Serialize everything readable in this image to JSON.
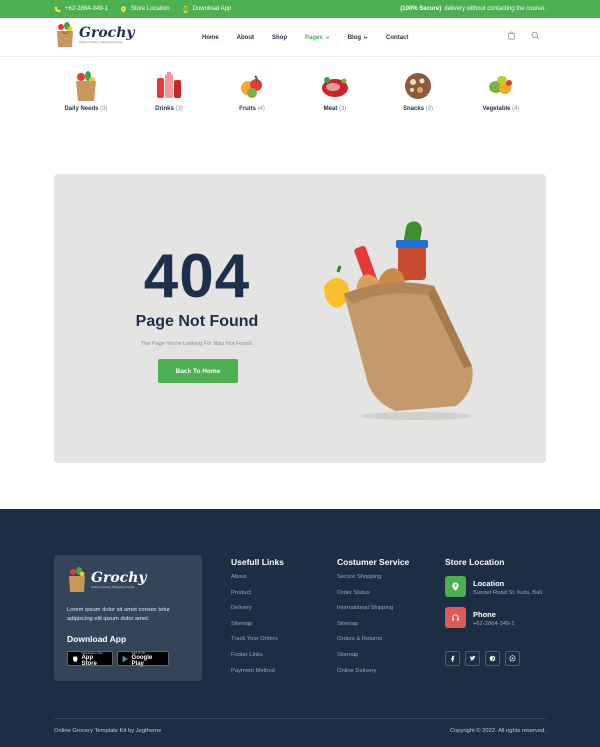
{
  "topbar": {
    "phone": "+62-2864-349-1",
    "store_location": "Store Location",
    "download_app": "Download App",
    "secure_bold": "(100% Secure)",
    "secure_text": "delivery without contacting the courier."
  },
  "brand": {
    "name": "Grochy",
    "tagline": "Online Grocery Shopping Center",
    "accent": "#4caf50",
    "navy": "#1e2f4d"
  },
  "nav": {
    "items": [
      {
        "label": "Home"
      },
      {
        "label": "About"
      },
      {
        "label": "Shop"
      },
      {
        "label": "Pages"
      },
      {
        "label": "Blog"
      },
      {
        "label": "Contact"
      }
    ],
    "active": "Pages"
  },
  "categories": [
    {
      "name": "Daily Needs",
      "count": "(3)",
      "icon": "bag-icon"
    },
    {
      "name": "Drinks",
      "count": "(3)",
      "icon": "drinks-icon"
    },
    {
      "name": "Fruits",
      "count": "(4)",
      "icon": "fruits-icon"
    },
    {
      "name": "Meat",
      "count": "(3)",
      "icon": "meat-icon"
    },
    {
      "name": "Snacks",
      "count": "(3)",
      "icon": "snacks-icon"
    },
    {
      "name": "Vegetable",
      "count": "(4)",
      "icon": "vegetable-icon"
    }
  ],
  "error": {
    "code": "404",
    "title": "Page Not Found",
    "message": "The Page You're Looking For Was Not Found.",
    "button": "Back To Home"
  },
  "footer": {
    "description": "Lorem ipsum dolor sit amet consec tetur adipiscing elit ipsum dolor amet.",
    "download_title": "Download App",
    "app_store_small": "Download on the",
    "app_store": "App Store",
    "google_play_small": "GET IT ON",
    "google_play": "Google Play",
    "useful_links": {
      "title": "Usefull Links",
      "items": [
        "About",
        "Product",
        "Delivery",
        "Sitemap",
        "Track Your Orders",
        "Footer Links",
        "Payment Method"
      ]
    },
    "customer_service": {
      "title": "Costumer Service",
      "items": [
        "Secure Shopping",
        "Order Status",
        "International Shipping",
        "Sitemap",
        "Orders & Returns",
        "Sitemap",
        "Online Delivery"
      ]
    },
    "store_location": {
      "title": "Store Location",
      "location_label": "Location",
      "location_value": "Sunnet Road St. Kuta, Bali",
      "phone_label": "Phone",
      "phone_value": "+62-2864-349-1"
    },
    "socials": [
      "facebook-icon",
      "twitter-icon",
      "pinterest-icon",
      "whatsapp-icon"
    ],
    "copyright_left": "Online Grocery Template Kit by Jegtheme",
    "copyright_right": "Copyright © 2022. All rights reserved."
  }
}
